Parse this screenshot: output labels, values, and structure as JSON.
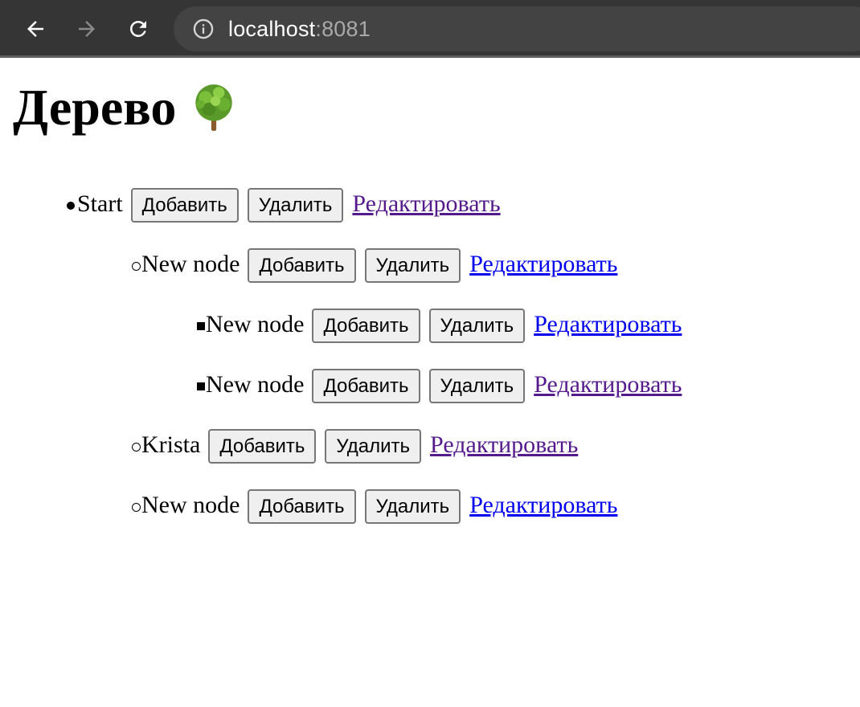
{
  "browser": {
    "url_host": "localhost",
    "url_port": ":8081",
    "icons": {
      "back": "arrow-left-icon",
      "forward": "arrow-right-icon",
      "reload": "reload-icon",
      "info": "info-icon"
    }
  },
  "page": {
    "title": "Дерево",
    "title_icon": "tree-icon"
  },
  "labels": {
    "add": "Добавить",
    "delete": "Удалить",
    "edit": "Редактировать"
  },
  "colors": {
    "link_visited": "#551a8b",
    "link_unvisited": "#0000ee"
  },
  "tree": [
    {
      "label": "Start",
      "level": 0,
      "edit_visited": true
    },
    {
      "label": "New node",
      "level": 1,
      "edit_visited": false
    },
    {
      "label": "New node",
      "level": 2,
      "edit_visited": false
    },
    {
      "label": "New node",
      "level": 2,
      "edit_visited": true
    },
    {
      "label": "Krista",
      "level": 1,
      "edit_visited": true
    },
    {
      "label": "New node",
      "level": 1,
      "edit_visited": false
    }
  ]
}
